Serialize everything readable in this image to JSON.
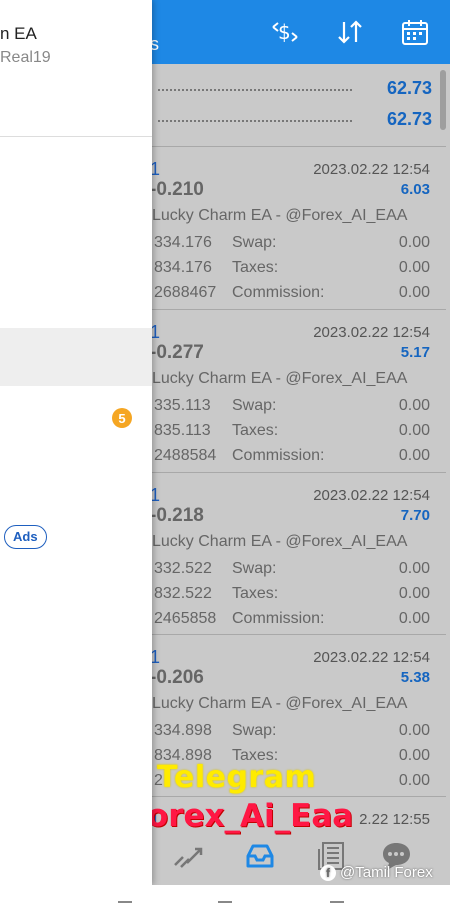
{
  "toolbar": {
    "title": "s",
    "icons": [
      "exchange-dollar-icon",
      "sort-icon",
      "calendar-icon"
    ]
  },
  "summary": [
    {
      "value": "62.73"
    },
    {
      "value": "62.73"
    }
  ],
  "trades": [
    {
      "id": "1",
      "date": "2023.02.22 12:54",
      "price": "-0.210",
      "profit": "6.03",
      "comment": "Lucky Charm EA - @Forex_AI_EAA",
      "rows": [
        {
          "left": "334.176",
          "key": "Swap:",
          "value": "0.00"
        },
        {
          "left": "834.176",
          "key": "Taxes:",
          "value": "0.00"
        },
        {
          "left": "2688467",
          "key": "Commission:",
          "value": "0.00"
        }
      ]
    },
    {
      "id": "1",
      "date": "2023.02.22 12:54",
      "price": "-0.277",
      "profit": "5.17",
      "comment": "Lucky Charm EA - @Forex_AI_EAA",
      "rows": [
        {
          "left": "335.113",
          "key": "Swap:",
          "value": "0.00"
        },
        {
          "left": "835.113",
          "key": "Taxes:",
          "value": "0.00"
        },
        {
          "left": "2488584",
          "key": "Commission:",
          "value": "0.00"
        }
      ]
    },
    {
      "id": "1",
      "date": "2023.02.22 12:54",
      "price": "-0.218",
      "profit": "7.70",
      "comment": "Lucky Charm EA - @Forex_AI_EAA",
      "rows": [
        {
          "left": "332.522",
          "key": "Swap:",
          "value": "0.00"
        },
        {
          "left": "832.522",
          "key": "Taxes:",
          "value": "0.00"
        },
        {
          "left": "2465858",
          "key": "Commission:",
          "value": "0.00"
        }
      ]
    },
    {
      "id": "1",
      "date": "2023.02.22 12:54",
      "price": "-0.206",
      "profit": "5.38",
      "comment": "Lucky Charm EA - @Forex_AI_EAA",
      "rows": [
        {
          "left": "334.898",
          "key": "Swap:",
          "value": "0.00"
        },
        {
          "left": "834.898",
          "key": "Taxes:",
          "value": "0.00"
        },
        {
          "left": "2",
          "key": "",
          "value": "0.00"
        }
      ]
    }
  ],
  "partial_trade": {
    "id": "1",
    "date": "2.22 12:55"
  },
  "drawer": {
    "account_name": "n EA",
    "account_server": "Real19",
    "badge_count": "5",
    "ads_label": "Ads"
  },
  "overlay": {
    "telegram": "Telegram",
    "handle": "@Forex_Ai_Eaa"
  },
  "watermark": {
    "text": "@Tamil Forex"
  },
  "bottom_nav": [
    "trade-chart-icon",
    "history-inbox-icon",
    "news-icon",
    "chat-icon"
  ],
  "colors": {
    "accent": "#1e88e5",
    "profit": "#1565c0",
    "telegram": "#ffeb00",
    "handle": "#ff1744"
  }
}
